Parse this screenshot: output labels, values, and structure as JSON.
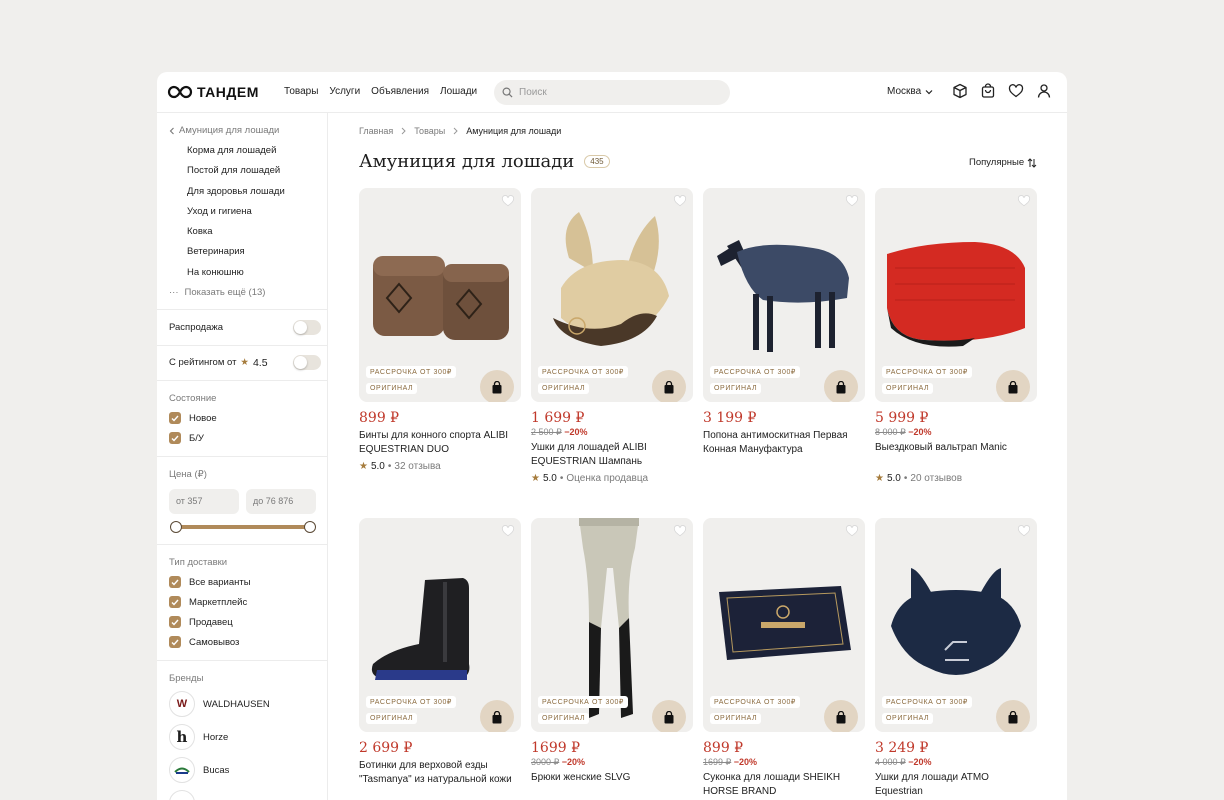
{
  "header": {
    "logo_text": "ТАНДЕМ",
    "nav": [
      "Товары",
      "Услуги",
      "Объявления",
      "Лошади"
    ],
    "search_placeholder": "Поиск",
    "city": "Москва"
  },
  "sidebar": {
    "back_label": "Амуниция для лошади",
    "categories": [
      "Корма для лошадей",
      "Постой для лошадей",
      "Для здоровья лошади",
      "Уход и гигиена",
      "Ковка",
      "Ветеринария",
      "На конюшню"
    ],
    "show_more": "Показать ещё (13)",
    "sale_label": "Распродажа",
    "rating_label": "С рейтингом от",
    "rating_value": "4.5",
    "condition_title": "Состояние",
    "condition": [
      "Новое",
      "Б/У"
    ],
    "price_title": "Цена (₽)",
    "price_from": "от 357",
    "price_to": "до 76 876",
    "delivery_title": "Тип доставки",
    "delivery": [
      "Все варианты",
      "Маркетплейс",
      "Продавец",
      "Самовывоз"
    ],
    "brands_title": "Бренды",
    "brands": [
      "WALDHAUSEN",
      "Horze",
      "Bucas"
    ]
  },
  "main": {
    "breadcrumb": [
      "Главная",
      "Товары",
      "Амуниция для лошади"
    ],
    "title": "Амуниция для лошади",
    "count": "435",
    "sort_label": "Популярные",
    "tag_installment": "Рассрочка от 300₽",
    "tag_original": "Оригинал"
  },
  "products": [
    {
      "price": "899 ₽",
      "old": "",
      "disc": "",
      "title": "Бинты для конного спорта ALIBI EQUESTRIAN DUO",
      "score": "5.0",
      "reviews": "32 отзыва"
    },
    {
      "price": "1 699 ₽",
      "old": "2 500 ₽",
      "disc": "−20%",
      "title": "Ушки для лошадей ALIBI EQUESTRIAN Шампань",
      "score": "5.0",
      "reviews": "Оценка продавца"
    },
    {
      "price": "3 199 ₽",
      "old": "",
      "disc": "",
      "title": "Попона антимоскитная Первая Конная Мануфактура",
      "score": "",
      "reviews": ""
    },
    {
      "price": "5 999 ₽",
      "old": "8 000 ₽",
      "disc": "−20%",
      "title": "Выездковый вальтрап Manic",
      "score": "5.0",
      "reviews": "20 отзывов"
    },
    {
      "price": "2 699 ₽",
      "old": "",
      "disc": "",
      "title": "Ботинки для верховой езды \"Tasmanya\" из натуральной кожи",
      "score": "",
      "reviews": ""
    },
    {
      "price": "1699 ₽",
      "old": "3000 ₽",
      "disc": "−20%",
      "title": "Брюки женские SLVG",
      "score": "",
      "reviews": ""
    },
    {
      "price": "899 ₽",
      "old": "1699 ₽",
      "disc": "−20%",
      "title": "Суконка для лошади SHEIKH HORSE BRAND",
      "score": "",
      "reviews": ""
    },
    {
      "price": "3 249 ₽",
      "old": "4 000 ₽",
      "disc": "−20%",
      "title": "Ушки для лошади ATMO Equestrian",
      "score": "",
      "reviews": ""
    }
  ],
  "colors": {
    "accent": "#b08a5a",
    "price": "#c0392b",
    "bg": "#f0efed"
  }
}
